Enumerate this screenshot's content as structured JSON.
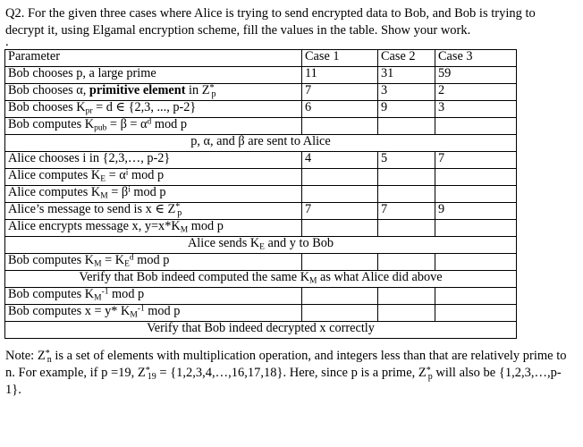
{
  "question": {
    "text": "Q2. For the given three cases where Alice is trying to send encrypted data to Bob, and Bob is trying to decrypt it,  using Elgamal encryption scheme, fill the values in the table. Show your work.",
    "trailing_mark": "."
  },
  "table": {
    "headers": {
      "parameter": "Parameter",
      "case1": "Case 1",
      "case2": "Case 2",
      "case3": "Case 3"
    },
    "rows": [
      {
        "type": "data",
        "label_plain": "Bob chooses p, a large prime",
        "label_parts": [
          {
            "t": "Bob chooses p, a large prime"
          }
        ],
        "case1": "11",
        "case2": "31",
        "case3": "59"
      },
      {
        "type": "data",
        "label_plain": "Bob chooses α, primitive element in Z*p",
        "label_parts": [
          {
            "t": "Bob chooses α, "
          },
          {
            "t": "primitive element",
            "bold": true
          },
          {
            "t": " in "
          },
          {
            "t": "Z",
            "zstar": true,
            "sup": "*",
            "sub": "p"
          }
        ],
        "case1": "7",
        "case2": "3",
        "case3": "2"
      },
      {
        "type": "data",
        "label_plain": "Bob chooses Kpr = d ∈ {2,3, ..., p-2}",
        "label_parts": [
          {
            "t": "Bob chooses K"
          },
          {
            "t": "pr",
            "sub": true
          },
          {
            "t": " = d ∈ {2,3, ..., p-2}"
          }
        ],
        "case1": "6",
        "case2": "9",
        "case3": "3"
      },
      {
        "type": "data",
        "label_plain": "Bob computes Kpub = β = αd mod p",
        "label_parts": [
          {
            "t": "Bob computes K"
          },
          {
            "t": "pub",
            "sub": true
          },
          {
            "t": " = β = α"
          },
          {
            "t": "d",
            "sup": true
          },
          {
            "t": " mod p"
          }
        ],
        "case1": "",
        "case2": "",
        "case3": ""
      },
      {
        "type": "merged",
        "label_plain": "p, α, and  β are sent to Alice",
        "label_parts": [
          {
            "t": "p, α, and  β are sent to Alice"
          }
        ]
      },
      {
        "type": "data",
        "label_plain": "Alice chooses i in {2,3,…, p-2}",
        "label_parts": [
          {
            "t": "Alice chooses i in  {2,3,…, p-2}"
          }
        ],
        "case1": "4",
        "case2": "5",
        "case3": "7"
      },
      {
        "type": "data",
        "label_plain": "Alice computes KE = αi mod p",
        "label_parts": [
          {
            "t": "Alice computes K"
          },
          {
            "t": "E",
            "sub": true
          },
          {
            "t": " = α"
          },
          {
            "t": "i",
            "sup": true
          },
          {
            "t": " mod p"
          }
        ],
        "case1": "",
        "case2": "",
        "case3": ""
      },
      {
        "type": "data",
        "label_plain": "Alice computes KM = βi mod p",
        "label_parts": [
          {
            "t": "Alice computes K"
          },
          {
            "t": "M",
            "sub": true
          },
          {
            "t": " = β"
          },
          {
            "t": "i",
            "sup": true
          },
          {
            "t": " mod p"
          }
        ],
        "case1": "",
        "case2": "",
        "case3": ""
      },
      {
        "type": "data",
        "label_plain": "Alice’s message to send is x ∈ Z*p",
        "label_parts": [
          {
            "t": "Alice’s message to send is x ∈ "
          },
          {
            "t": "Z",
            "zstar": true,
            "sup": "*",
            "sub": "p"
          }
        ],
        "case1": "7",
        "case2": "7",
        "case3": "9"
      },
      {
        "type": "data",
        "label_plain": "Alice encrypts message x, y=x*KM mod p",
        "label_parts": [
          {
            "t": "Alice encrypts message x, y=x*K"
          },
          {
            "t": "M",
            "sub": true
          },
          {
            "t": " mod p"
          }
        ],
        "case1": "",
        "case2": "",
        "case3": ""
      },
      {
        "type": "merged",
        "label_plain": "Alice sends KE  and y to Bob",
        "label_parts": [
          {
            "t": "Alice sends K"
          },
          {
            "t": "E",
            "sub": true
          },
          {
            "t": "  and y to Bob"
          }
        ]
      },
      {
        "type": "data",
        "label_plain": "Bob computes KM = KEd mod p",
        "label_parts": [
          {
            "t": "Bob computes K"
          },
          {
            "t": "M",
            "sub": true
          },
          {
            "t": " = K"
          },
          {
            "t": "E",
            "sub": true
          },
          {
            "t": "d",
            "sup": true
          },
          {
            "t": " mod p"
          }
        ],
        "case1": "",
        "case2": "",
        "case3": ""
      },
      {
        "type": "merged",
        "label_plain": "Verify that Bob indeed computed the same KM  as what Alice did above",
        "label_parts": [
          {
            "t": "Verify that Bob indeed computed the same K"
          },
          {
            "t": "M",
            "sub": true
          },
          {
            "t": "  as what Alice did above"
          }
        ]
      },
      {
        "type": "data",
        "label_plain": "Bob computes KM-1 mod p",
        "label_parts": [
          {
            "t": "Bob computes K"
          },
          {
            "t": "M",
            "sub": true
          },
          {
            "t": "-1",
            "sup": true
          },
          {
            "t": " mod p"
          }
        ],
        "case1": "",
        "case2": "",
        "case3": ""
      },
      {
        "type": "data",
        "label_plain": "Bob computes x = y* KM-1 mod p",
        "label_parts": [
          {
            "t": "Bob computes x = y* K"
          },
          {
            "t": "M",
            "sub": true
          },
          {
            "t": "-1",
            "sup": true
          },
          {
            "t": " mod p"
          }
        ],
        "case1": "",
        "case2": "",
        "case3": ""
      },
      {
        "type": "merged",
        "label_plain": "Verify that Bob indeed decrypted x correctly",
        "label_parts": [
          {
            "t": "Verify that Bob indeed decrypted x correctly"
          }
        ]
      }
    ]
  },
  "note": {
    "text_plain": "Note: Z*n is a set of elements with multiplication operation, and integers less than that are relatively prime to n. For example, if p =19, Z*19 = {1,2,3,4,…,16,17,18}. Here, since p is a prime, Z*p will also be {1,2,3,…,p-1}.",
    "parts": [
      {
        "t": "Note: "
      },
      {
        "t": "Z",
        "zstar": true,
        "sup": "*",
        "sub": "n"
      },
      {
        "t": " is a set of elements with multiplication operation, and integers less than that are relatively prime to n. For example, if p =19, "
      },
      {
        "t": "Z",
        "zstar": true,
        "sup": "*",
        "sub": "19"
      },
      {
        "t": " = {1,2,3,4,…,16,17,18}. Here, since p is a prime, "
      },
      {
        "t": "Z",
        "zstar": true,
        "sup": "*",
        "sub": "p"
      },
      {
        "t": " will also be {1,2,3,…,p-1}."
      }
    ]
  }
}
